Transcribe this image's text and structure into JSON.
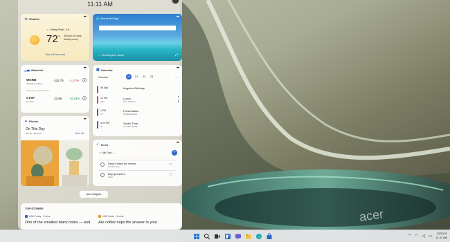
{
  "board": {
    "time": "11:11 AM"
  },
  "weather": {
    "title": "Weather",
    "location": "Valley Park, CA",
    "temp": "72",
    "unit": "°F",
    "condition": "Strong UV today",
    "subcondition": "Mostly sunny",
    "forecast_link": "See full forecast"
  },
  "edge": {
    "title": "Microsoft Edge",
    "caption": "Iriomote-jima, Japan"
  },
  "watchlist": {
    "title": "Watchlist",
    "note": "You may be interested in",
    "stocks": [
      {
        "symbol": "WGRB",
        "name": "Woodgrove Bank",
        "price": "433.75",
        "change": "-1.27%",
        "button": "+"
      },
      {
        "symbol": "CTSP",
        "name": "Contoso",
        "price": "23.86",
        "change": "+2.23%",
        "button": "+"
      }
    ],
    "colors": {
      "down": "#c2364b",
      "up": "#1c8a3a"
    }
  },
  "calendar": {
    "title": "Calendar",
    "month": "October",
    "days": [
      "20",
      "21",
      "22",
      "23"
    ],
    "selected_day": "20",
    "events": [
      {
        "time": "All Day",
        "duration": "",
        "title": "Angela's Birthday",
        "sub": "",
        "color": "#d63c7a"
      },
      {
        "time": "12 PM",
        "duration": "30m",
        "title": "Lunch",
        "sub": "Alex Johnson",
        "color": "#d63c7a"
      },
      {
        "time": "1 PM",
        "duration": "1h",
        "title": "Presentation",
        "sub": "Skype Meeting",
        "color": "#2b67c8"
      },
      {
        "time": "6:00 PM",
        "duration": "2h",
        "title": "Studio Time",
        "sub": "Conf Rm 32/35",
        "color": "#2b67c8"
      }
    ]
  },
  "photos": {
    "title": "Photos",
    "heading": "On This Day",
    "date": "Oct 20 · 33 items",
    "see_all": "See all"
  },
  "todo": {
    "title": "To Do",
    "list_name": "My Day",
    "tasks": [
      {
        "title": "Send invites for review",
        "sub": "Q4 planning"
      },
      {
        "title": "Buy groceries",
        "sub": "Tasks"
      }
    ]
  },
  "add_widgets": "Add widgets",
  "stories": {
    "header": "TOP STORIES",
    "items": [
      {
        "source": "USA Today · 3 mins",
        "title": "One of the smallest black holes — and",
        "logo_color": "#2b67c8"
      },
      {
        "source": "NBC News · 5 mins",
        "title": "Are coffee naps the answer to your",
        "logo_color": "#e5a024"
      }
    ]
  },
  "taskbar": {
    "date": "10/20/21",
    "time": "11:11 AM",
    "icons": [
      "start-icon",
      "search-icon",
      "task-view-icon",
      "widgets-icon",
      "chat-icon",
      "file-explorer-icon",
      "edge-icon",
      "store-icon"
    ]
  }
}
